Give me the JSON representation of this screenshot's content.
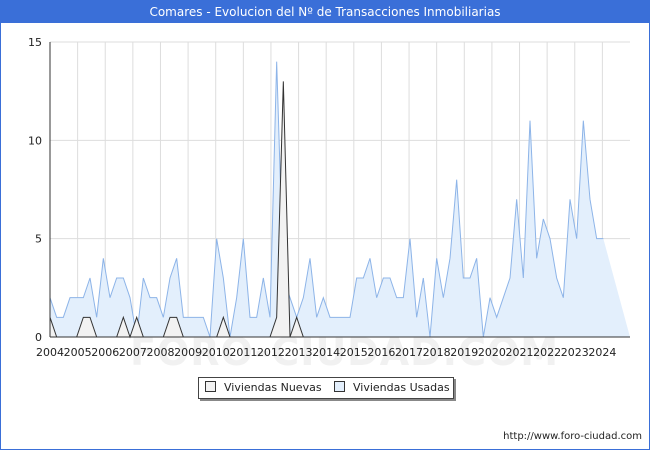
{
  "title": "Comares - Evolucion del Nº de Transacciones Inmobiliarias",
  "footer": "http://www.foro-ciudad.com",
  "watermark": "FORO-CIUDAD.COM",
  "colors": {
    "header_bg": "#3a6fd8",
    "nuevas_fill": "#f2f2f2",
    "nuevas_line": "#333333",
    "usadas_fill": "#e3effc",
    "usadas_line": "#8db4e8",
    "grid": "#dddddd"
  },
  "chart_data": {
    "type": "area",
    "title": "Comares - Evolucion del Nº de Transacciones Inmobiliarias",
    "xlabel": "",
    "ylabel": "",
    "x_ticks": [
      "2004",
      "2005",
      "2006",
      "2007",
      "2008",
      "2009",
      "2010",
      "2011",
      "2012",
      "2013",
      "2014",
      "2015",
      "2016",
      "2017",
      "2018",
      "2019",
      "2020",
      "2021",
      "2022",
      "2023",
      "2024"
    ],
    "x_start": "2004 Q1",
    "x_end": "2024 Q4",
    "y_ticks": [
      "0",
      "5",
      "10",
      "15"
    ],
    "ylim": [
      0,
      15
    ],
    "grid": true,
    "legend_position": "bottom",
    "series": [
      {
        "name": "Viviendas Nuevas",
        "values": [
          1,
          0,
          0,
          0,
          0,
          1,
          1,
          0,
          0,
          0,
          0,
          1,
          0,
          1,
          0,
          0,
          0,
          0,
          1,
          1,
          0,
          0,
          0,
          0,
          0,
          0,
          1,
          0,
          0,
          0,
          0,
          0,
          0,
          0,
          1,
          13,
          0,
          1,
          0,
          0,
          0,
          0,
          0,
          0,
          0,
          0,
          0,
          0,
          0,
          0,
          0,
          0,
          0,
          0,
          0,
          0,
          0,
          0,
          0,
          0,
          0,
          0,
          0,
          0,
          0,
          0,
          0,
          0,
          0,
          0,
          0,
          0,
          0,
          0,
          0,
          0,
          0,
          0,
          0,
          0,
          0,
          0,
          0,
          0,
          0,
          0,
          0,
          0
        ]
      },
      {
        "name": "Viviendas Usadas",
        "values": [
          2,
          1,
          1,
          2,
          2,
          2,
          3,
          1,
          4,
          2,
          3,
          3,
          2,
          0,
          3,
          2,
          2,
          1,
          3,
          4,
          1,
          1,
          1,
          1,
          0,
          5,
          3,
          0,
          2,
          5,
          1,
          1,
          3,
          1,
          14,
          3,
          2,
          1,
          2,
          4,
          1,
          2,
          1,
          1,
          1,
          1,
          3,
          3,
          4,
          2,
          3,
          3,
          2,
          2,
          5,
          1,
          3,
          0,
          4,
          2,
          4,
          8,
          3,
          3,
          4,
          0,
          2,
          1,
          2,
          3,
          7,
          3,
          11,
          4,
          6,
          5,
          3,
          2,
          7,
          5,
          11,
          7,
          5,
          5
        ]
      }
    ]
  },
  "legend": [
    {
      "label": "Viviendas Nuevas"
    },
    {
      "label": "Viviendas Usadas"
    }
  ]
}
